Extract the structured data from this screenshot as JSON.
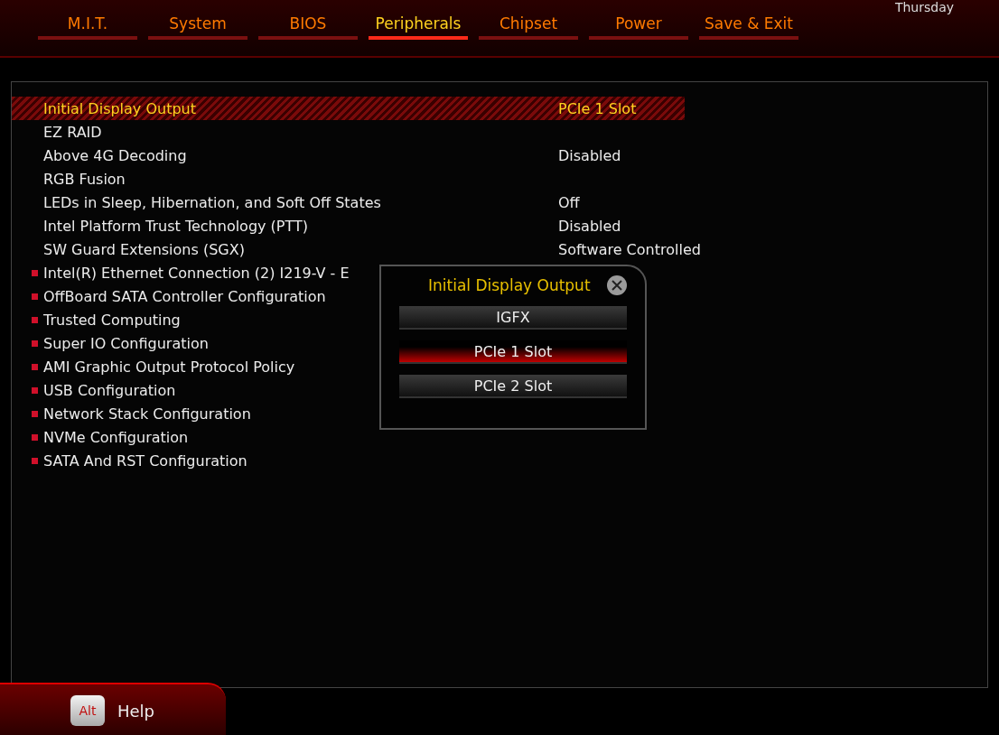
{
  "tabs": [
    {
      "label": "M.I.T.",
      "selected": false
    },
    {
      "label": "System",
      "selected": false
    },
    {
      "label": "BIOS",
      "selected": false
    },
    {
      "label": "Peripherals",
      "selected": true
    },
    {
      "label": "Chipset",
      "selected": false
    },
    {
      "label": "Power",
      "selected": false
    },
    {
      "label": "Save & Exit",
      "selected": false
    }
  ],
  "day": "Thursday",
  "items": [
    {
      "kind": "setting",
      "label": "Initial Display Output",
      "value": "PCIe 1 Slot",
      "selected": true
    },
    {
      "kind": "setting",
      "label": "EZ RAID",
      "selected": false
    },
    {
      "kind": "setting",
      "label": "Above 4G Decoding",
      "value": "Disabled",
      "selected": false
    },
    {
      "kind": "setting",
      "label": "RGB Fusion",
      "selected": false
    },
    {
      "kind": "setting",
      "label": "LEDs in Sleep, Hibernation, and Soft Off States",
      "value": "Off",
      "selected": false
    },
    {
      "kind": "setting",
      "label": "Intel Platform Trust Technology (PTT)",
      "value": "Disabled",
      "selected": false
    },
    {
      "kind": "setting",
      "label": "SW Guard Extensions (SGX)",
      "value": "Software Controlled",
      "selected": false
    },
    {
      "kind": "submenu",
      "label": "Intel(R) Ethernet Connection (2) I219-V - E",
      "selected": false
    },
    {
      "kind": "submenu",
      "label": "OffBoard SATA Controller Configuration",
      "selected": false
    },
    {
      "kind": "submenu",
      "label": "Trusted Computing",
      "selected": false
    },
    {
      "kind": "submenu",
      "label": "Super IO Configuration",
      "selected": false
    },
    {
      "kind": "submenu",
      "label": "AMI Graphic Output Protocol Policy",
      "selected": false
    },
    {
      "kind": "submenu",
      "label": "USB Configuration",
      "selected": false
    },
    {
      "kind": "submenu",
      "label": "Network Stack Configuration",
      "selected": false
    },
    {
      "kind": "submenu",
      "label": "NVMe Configuration",
      "selected": false
    },
    {
      "kind": "submenu",
      "label": "SATA And RST Configuration",
      "selected": false
    }
  ],
  "popup": {
    "title": "Initial Display Output",
    "options": [
      {
        "label": "IGFX",
        "selected": false
      },
      {
        "label": "PCIe 1 Slot",
        "selected": true
      },
      {
        "label": "PCIe 2 Slot",
        "selected": false
      }
    ]
  },
  "footer": {
    "key": "Alt",
    "label": "Help"
  }
}
